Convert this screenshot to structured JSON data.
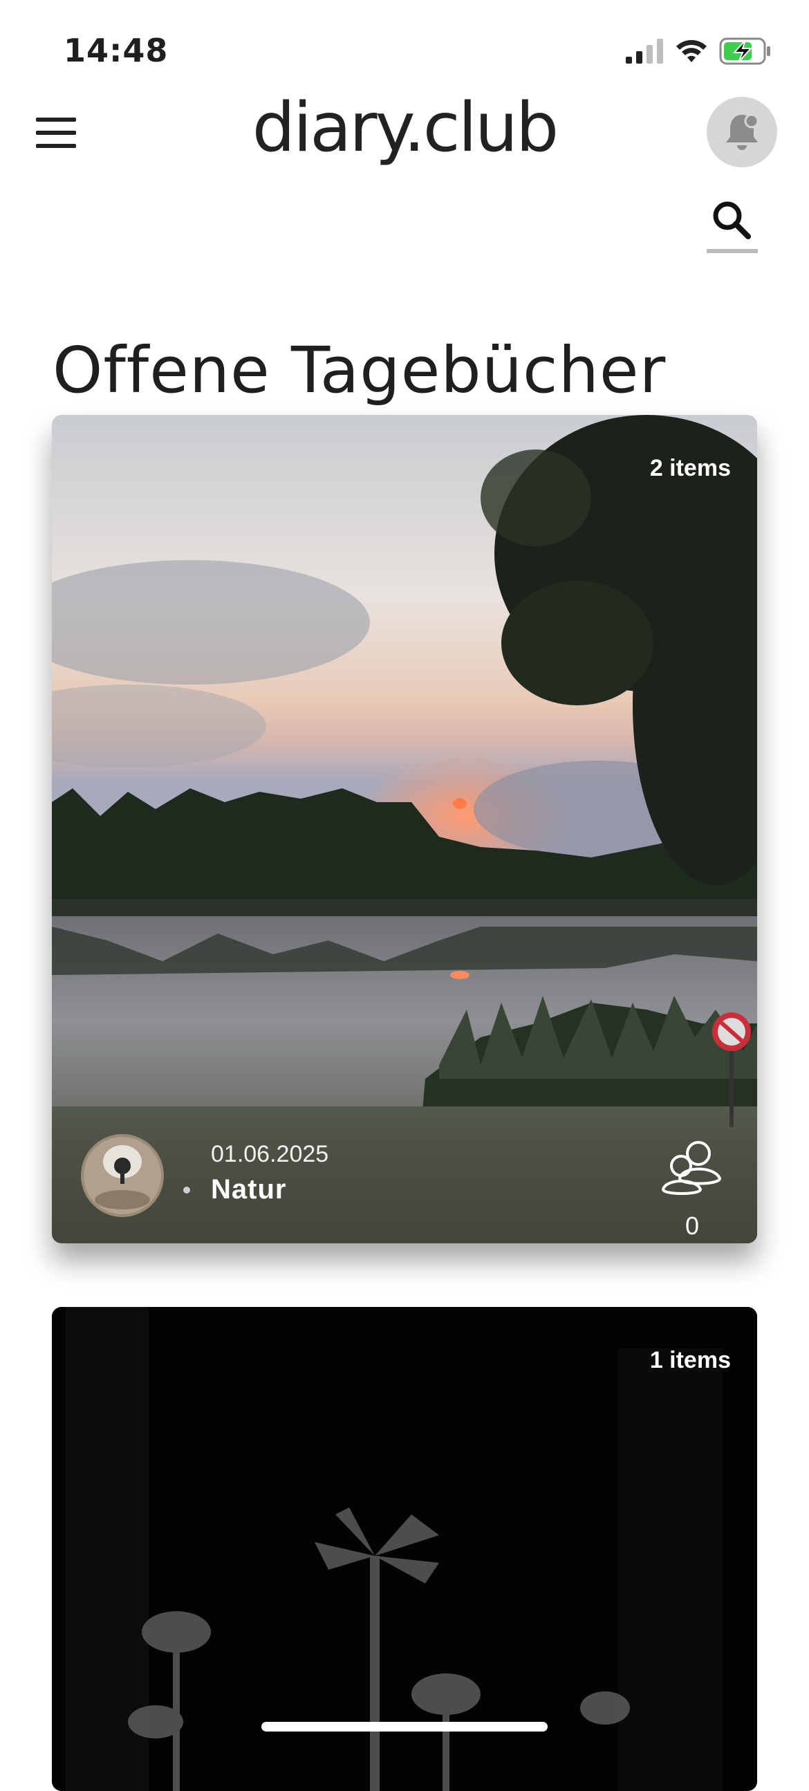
{
  "status_bar": {
    "time": "14:48"
  },
  "header": {
    "logo": "diary.club"
  },
  "page": {
    "title": "Offene Tagebücher"
  },
  "diaries": [
    {
      "items": "2 items",
      "date": "01.06.2025",
      "category": "Natur",
      "members": "0"
    },
    {
      "items": "1 items"
    }
  ],
  "icons": [
    "menu-icon",
    "bell-icon",
    "search-icon",
    "members-icon",
    "signal-icon",
    "wifi-icon",
    "battery-charging-icon"
  ]
}
